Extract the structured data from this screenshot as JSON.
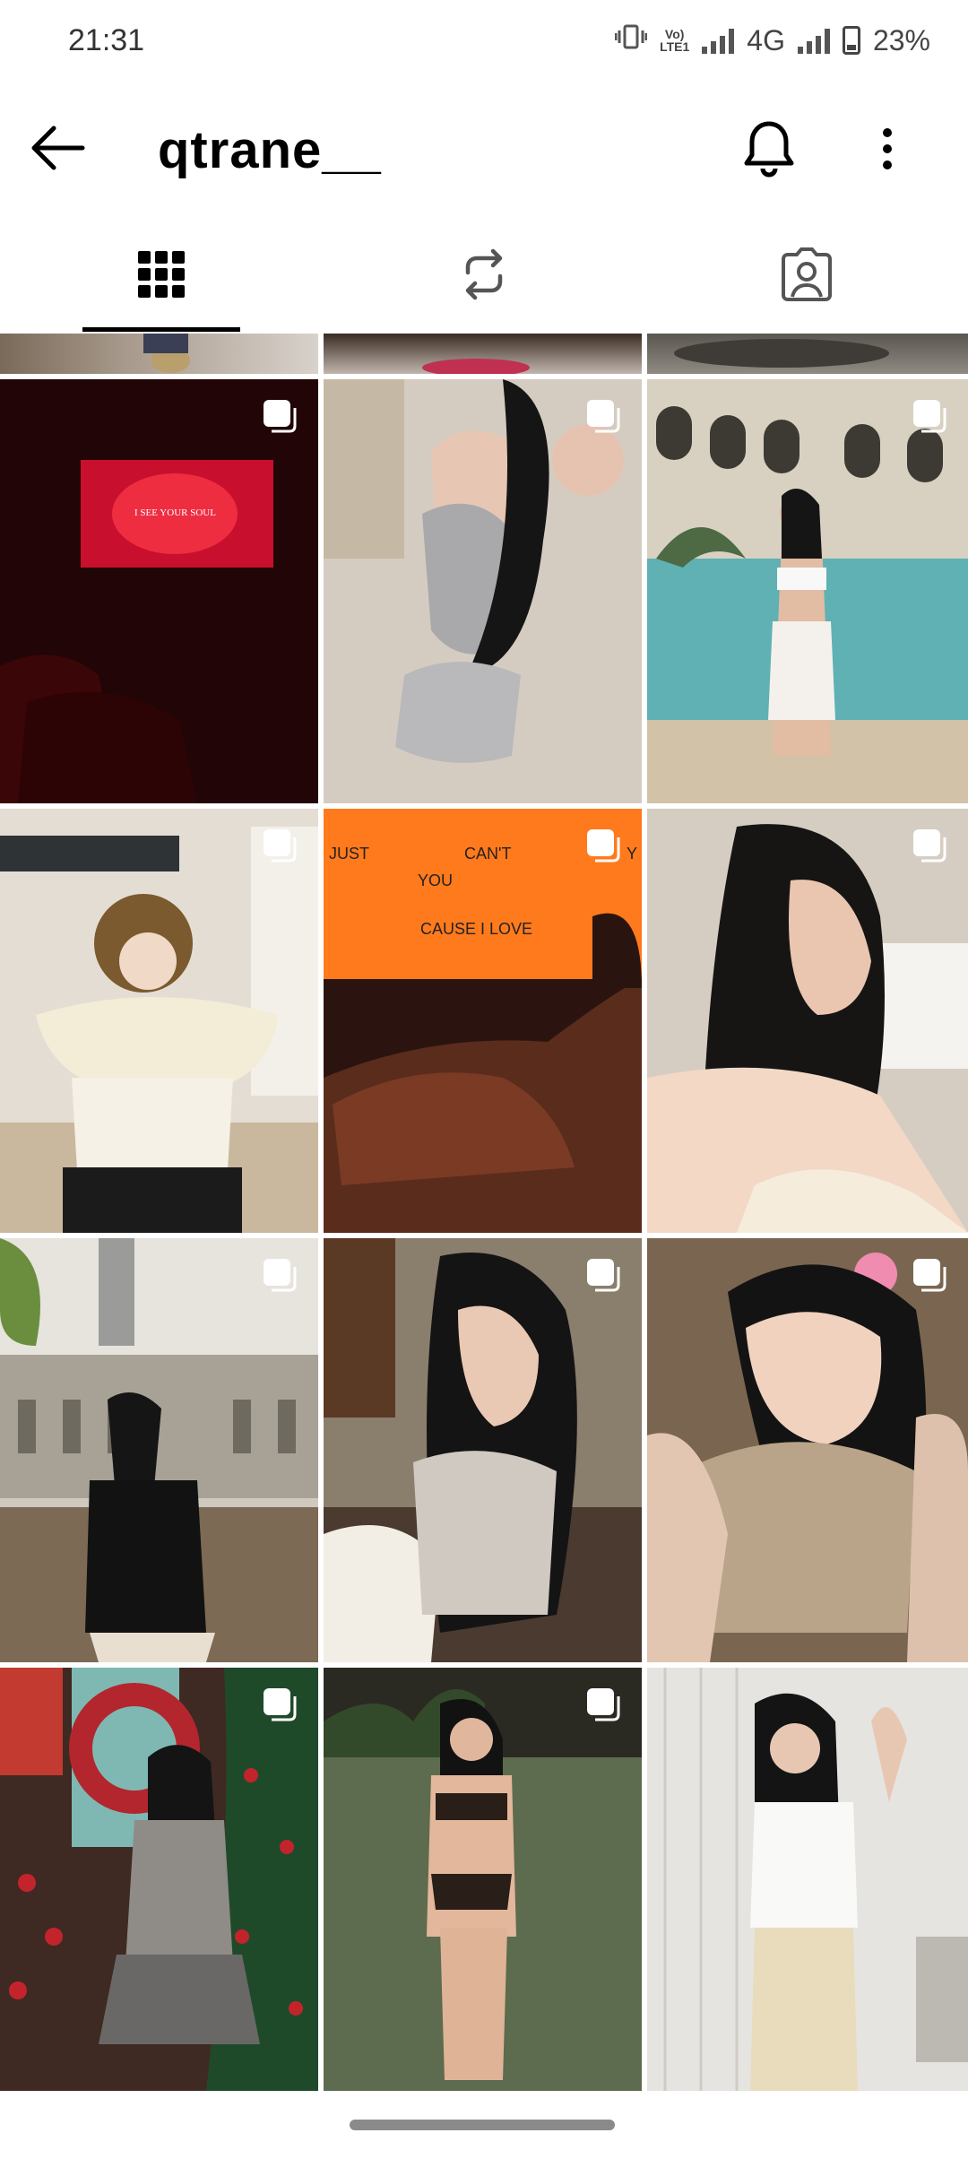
{
  "status_bar": {
    "time": "21:31",
    "network": "4G",
    "volte_top": "Vo)",
    "volte_bottom": "LTE1",
    "battery": "23%"
  },
  "header": {
    "username": "qtrane__",
    "icons": [
      "back-arrow-icon",
      "bell-icon",
      "more-vertical-icon"
    ]
  },
  "tabs": [
    {
      "name": "posts-grid",
      "icon": "grid-icon",
      "selected": true
    },
    {
      "name": "reposts",
      "icon": "repost-icon",
      "selected": false
    },
    {
      "name": "tagged",
      "icon": "tagged-person-icon",
      "selected": false
    }
  ],
  "posts": [
    {
      "id": "p1",
      "overlay_text": "I SEE YOUR SOUL",
      "multi": true
    },
    {
      "id": "p2",
      "multi": true
    },
    {
      "id": "p3",
      "multi": true
    },
    {
      "id": "p4",
      "multi": true
    },
    {
      "id": "p5",
      "overlay_text_1": "JUST",
      "overlay_text_2": "CAN'T",
      "overlay_text_3": "YOU",
      "overlay_text_4": "CAUSE I LOVE",
      "overlay_text_5": "Y",
      "multi": true
    },
    {
      "id": "p6",
      "multi": true
    },
    {
      "id": "p7",
      "multi": true
    },
    {
      "id": "p8",
      "multi": true
    },
    {
      "id": "p9",
      "multi": true
    },
    {
      "id": "p10",
      "multi": true
    },
    {
      "id": "p11",
      "multi": true
    },
    {
      "id": "p12",
      "multi": false
    }
  ]
}
